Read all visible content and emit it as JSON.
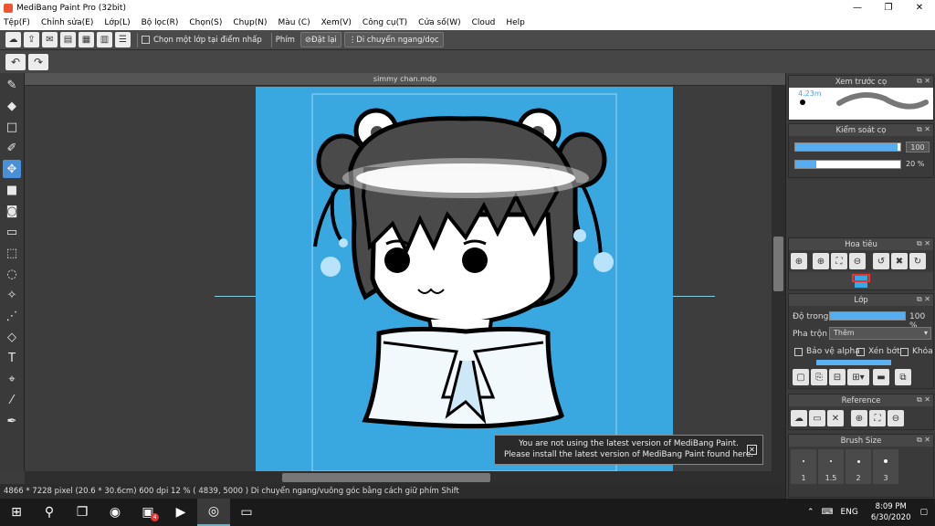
{
  "window": {
    "title": "MediBang Paint Pro (32bit)"
  },
  "menu": [
    "Tệp(F)",
    "Chỉnh sửa(E)",
    "Lớp(L)",
    "Bộ lọc(R)",
    "Chọn(S)",
    "Chụp(N)",
    "Màu (C)",
    "Xem(V)",
    "Công cụ(T)",
    "Cửa số(W)",
    "Cloud",
    "Help"
  ],
  "toolbar": {
    "select_layer_label": "Chọn một lớp tại điểm nhấp",
    "phim_label": "Phím",
    "reset_label": "Đặt lại",
    "move_label": "Di chuyển ngang/dọc"
  },
  "document": {
    "tab_name": "simmy chan.mdp"
  },
  "status": {
    "text": "4866 * 7228 pixel   (20.6 * 30.6cm)   600 dpi   12 %   ( 4839, 5000 )   Di chuyển ngang/vuông góc bằng cách giữ phím Shift"
  },
  "panels": {
    "brush_preview": {
      "title": "Xem trước cọ",
      "size_label": "4.23m"
    },
    "brush_control": {
      "title": "Kiểm soát cọ",
      "size_value": "100",
      "opacity_value": "20 %",
      "size_fraction": 0.97,
      "opacity_fraction": 0.2
    },
    "navigator": {
      "title": "Hoa tiêu"
    },
    "layer": {
      "title": "Lớp",
      "opacity_label": "Độ trong",
      "opacity_value": "100 %",
      "blend_label": "Pha trộn",
      "blend_value": "Thêm",
      "protect_alpha": "Bảo vệ alpha",
      "clipping": "Xén bớt",
      "lock": "Khóa"
    },
    "reference": {
      "title": "Reference"
    },
    "brush_size": {
      "title": "Brush Size",
      "sizes": [
        "1",
        "1.5",
        "2",
        "3"
      ]
    }
  },
  "toast": {
    "line1": "You are not using the latest version of MediBang Paint.",
    "line2": "Please install the latest version of MediBang Paint found here."
  },
  "taskbar": {
    "lang": "ENG",
    "time": "8:09 PM",
    "date": "6/30/2020",
    "badge": "4"
  },
  "colors": {
    "accent": "#4a90d9",
    "paper": "#3aa8e0"
  }
}
